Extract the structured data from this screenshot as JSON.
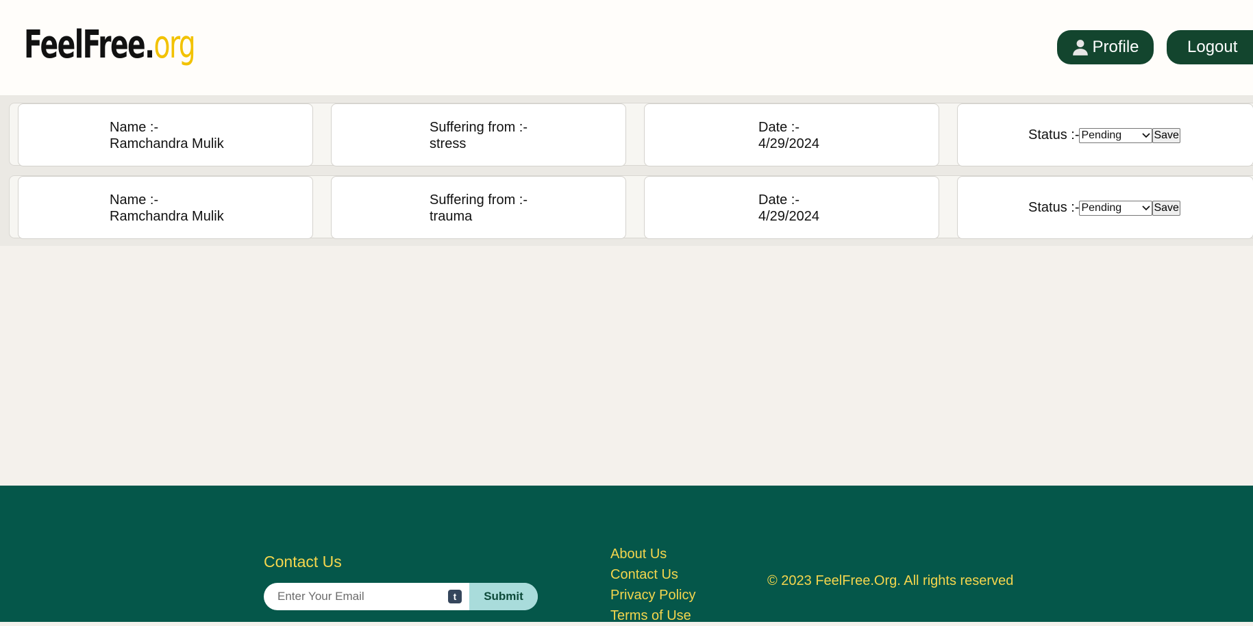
{
  "header": {
    "logo_main": "FeelFree.",
    "logo_tld": "org",
    "profile_label": "Profile",
    "logout_label": "Logout"
  },
  "appointments": [
    {
      "name_label": "Name :-",
      "name": "Ramchandra Mulik",
      "suffering_label": "Suffering from :-",
      "suffering": "stress",
      "date_label": "Date :-",
      "date": "4/29/2024",
      "status_label": "Status :-",
      "status": "Pending",
      "save_label": "Save"
    },
    {
      "name_label": "Name :-",
      "name": "Ramchandra Mulik",
      "suffering_label": "Suffering from :-",
      "suffering": "trauma",
      "date_label": "Date :-",
      "date": "4/29/2024",
      "status_label": "Status :-",
      "status": "Pending",
      "save_label": "Save"
    }
  ],
  "footer": {
    "contact_title": "Contact Us",
    "email_placeholder": "Enter Your Email",
    "tumblr_glyph": "t",
    "submit_label": "Submit",
    "links": [
      "About Us",
      "Contact Us",
      "Privacy Policy",
      "Terms of Use"
    ],
    "copyright": "© 2023 FeelFree.Org. All rights reserved"
  },
  "colors": {
    "header_bg": "#fffdfa",
    "page_bg": "#f4f1ec",
    "button_green": "#13452e",
    "footer_bg": "#05574a",
    "footer_text": "#f5d64d",
    "logo_accent": "#f2c200"
  }
}
